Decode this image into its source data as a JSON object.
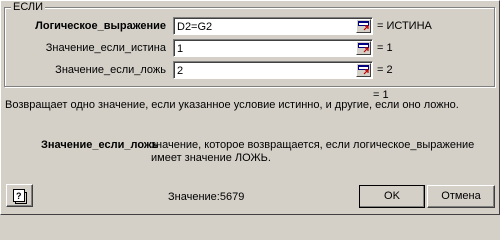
{
  "group_title": "ЕСЛИ",
  "args": [
    {
      "label": "Логическое_выражение",
      "value": "D2=G2",
      "result": "= ИСТИНА",
      "bold": true
    },
    {
      "label": "Значение_если_истина",
      "value": "1",
      "result": "= 1",
      "bold": false
    },
    {
      "label": "Значение_если_ложь",
      "value": "2",
      "result": "= 2",
      "bold": false
    }
  ],
  "formula_result": "= 1",
  "description": "Возвращает одно значение, если указанное условие истинно, и другие, если оно ложно.",
  "arg_description": {
    "name": "Значение_если_ложь",
    "line1": "значение, которое возвращается, если логическое_выражение",
    "line2": "имеет значение ЛОЖЬ."
  },
  "value_line": "Значение:5679",
  "buttons": {
    "ok": "OK",
    "cancel": "Отмена",
    "help_icon": "help-question-icon"
  },
  "collapse_icon": "collapse-dialog-icon"
}
